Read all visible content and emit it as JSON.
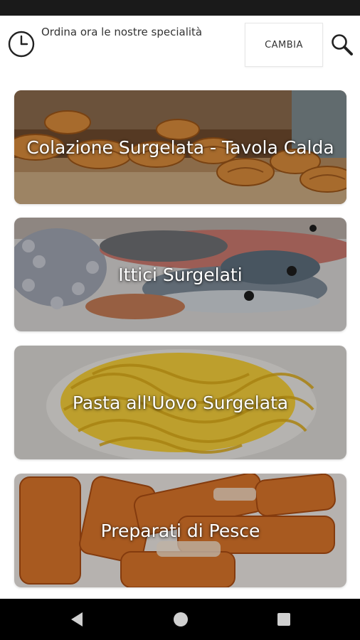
{
  "header": {
    "tagline": "Ordina ora le nostre specialità",
    "change_label": "CAMBIA"
  },
  "icons": {
    "clock": "clock-icon",
    "search": "search-icon"
  },
  "categories": [
    {
      "label": "Colazione Surgelata - Tavola Calda",
      "image": "croissants"
    },
    {
      "label": "Ittici Surgelati",
      "image": "fish-and-octopus"
    },
    {
      "label": "Pasta all'Uovo Surgelata",
      "image": "egg-tagliatelle"
    },
    {
      "label": "Preparati di Pesce",
      "image": "fish-sticks"
    }
  ],
  "navigation": {
    "back": "back-icon",
    "home": "home-icon",
    "recents": "recents-icon"
  }
}
